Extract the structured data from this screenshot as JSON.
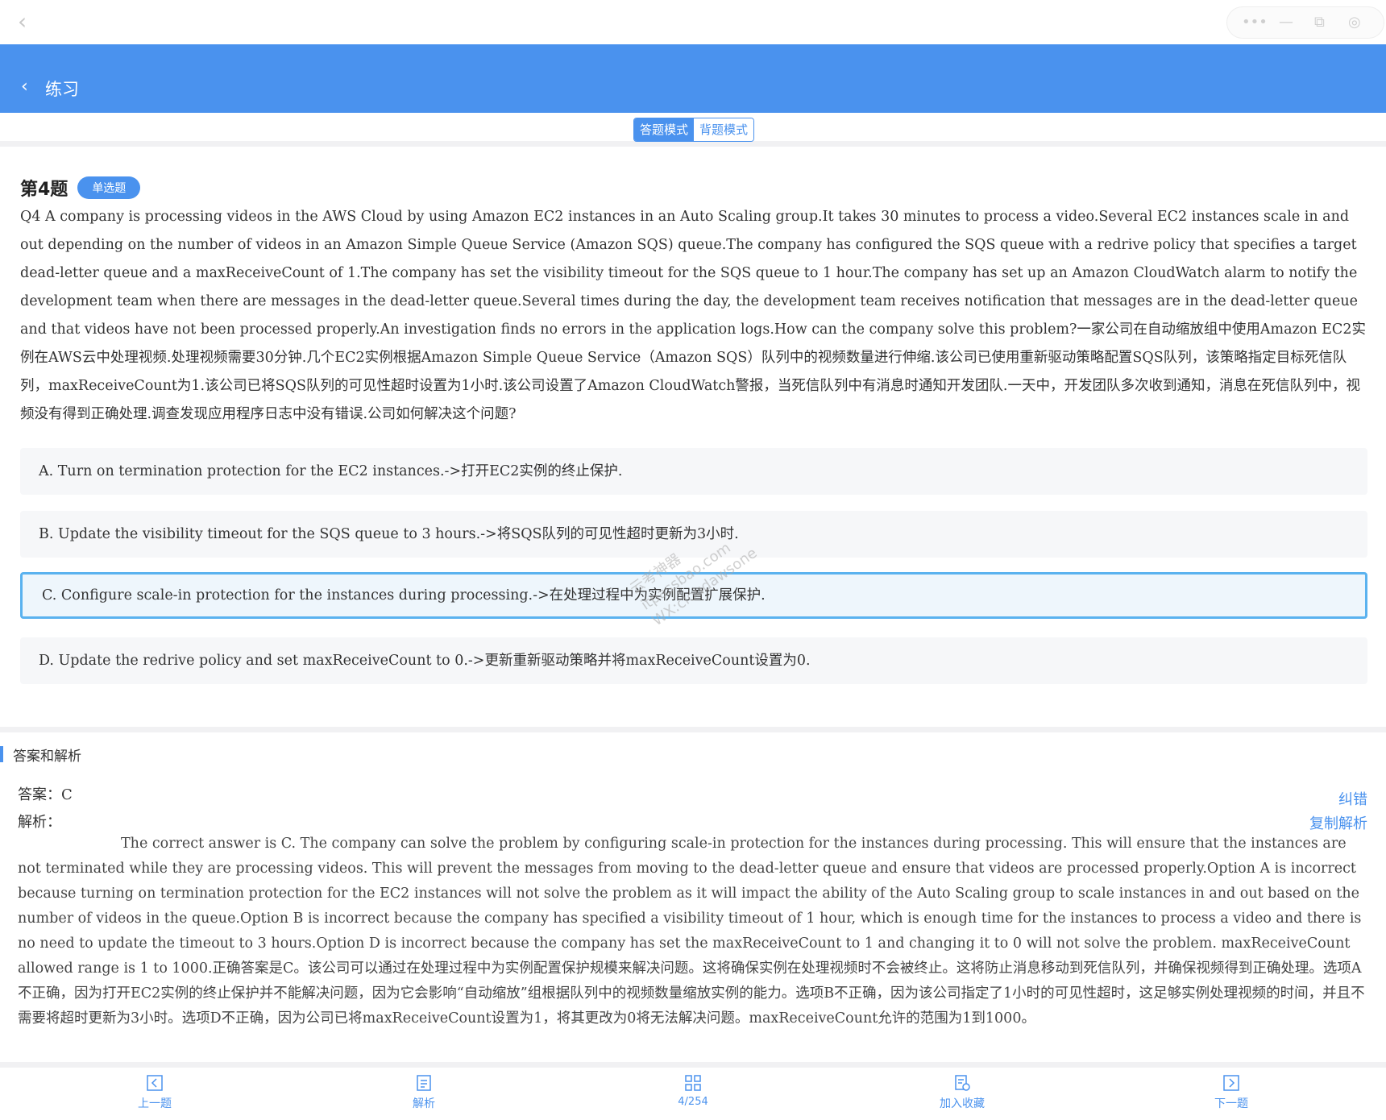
{
  "topbar": {
    "back_icon": "chevron-left-icon",
    "capsule_icons": [
      "more-dots-icon",
      "minimize-icon",
      "restore-icon",
      "close-circle-icon"
    ]
  },
  "header": {
    "back_glyph": "‹",
    "title": "练习"
  },
  "mode": {
    "answer_mode": "答题模式",
    "recite_mode": "背题模式"
  },
  "question": {
    "number": "第4题",
    "type": "单选题",
    "text": "Q4 A company is processing videos in the AWS Cloud by using Amazon EC2 instances in an Auto Scaling group.It takes 30 minutes to process a video.Several EC2 instances scale in and out depending on the number of videos in an Amazon Simple Queue Service (Amazon SQS) queue.The company has configured the SQS queue with a redrive policy that specifies a target dead-letter queue and a maxReceiveCount of 1.The company has set the visibility timeout for the SQS queue to 1 hour.The company has set up an Amazon CloudWatch alarm to notify the development team when there are messages in the dead-letter queue.Several times during the day, the development team receives notification that messages are in the dead-letter queue and that videos have not been processed properly.An investigation finds no errors in the application logs.How can the company solve this problem?一家公司在自动缩放组中使用Amazon EC2实例在AWS云中处理视频.处理视频需要30分钟.几个EC2实例根据Amazon Simple Queue Service（Amazon SQS）队列中的视频数量进行伸缩.该公司已使用重新驱动策略配置SQS队列，该策略指定目标死信队列，maxReceiveCount为1.该公司已将SQS队列的可见性超时设置为1小时.该公司设置了Amazon CloudWatch警报，当死信队列中有消息时通知开发团队.一天中，开发团队多次收到通知，消息在死信队列中，视频没有得到正确处理.调查发现应用程序日志中没有错误.公司如何解决这个问题?",
    "options": [
      {
        "text": "A. Turn on termination protection for the EC2 instances.->打开EC2实例的终止保护."
      },
      {
        "text": "B. Update the visibility timeout for the SQS queue to 3 hours.->将SQS队列的可见性超时更新为3小时."
      },
      {
        "text": "C. Configure scale-in protection for the instances during processing.->在处理过程中为实例配置扩展保护."
      },
      {
        "text": "D. Update the redrive policy and set maxReceiveCount to 0.->更新重新驱动策略并将maxReceiveCount设置为0."
      }
    ],
    "selected": "C"
  },
  "watermark": {
    "lines": [
      "云考神器",
      "itpassbao.com",
      "WX:cloudawsone"
    ]
  },
  "answer": {
    "section_title": "答案和解析",
    "answer_label": "答案：",
    "answer_value": "C",
    "analysis_label": "解析：",
    "report_error": "纠错",
    "copy_analysis": "复制解析",
    "analysis_text": "The correct answer is C. The company can solve the problem by configuring scale-in protection for the instances during processing. This will ensure that the instances are not terminated while they are processing videos. This will prevent the messages from moving to the dead-letter queue and ensure that videos are processed properly.Option A is incorrect because turning on termination protection for the EC2 instances will not solve the problem as it will impact the ability of the Auto Scaling group to scale instances in and out based on the number of videos in the queue.Option B is incorrect because the company has specified a visibility timeout of 1 hour, which is enough time for the instances to process a video and there is no need to update the timeout to 3 hours.Option D is incorrect because the company has set the maxReceiveCount to 1 and changing it to 0 will not solve the problem. maxReceiveCount allowed range is 1 to 1000.正确答案是C。该公司可以通过在处理过程中为实例配置保护规模来解决问题。这将确保实例在处理视频时不会被终止。这将防止消息移动到死信队列，并确保视频得到正确处理。选项A不正确，因为打开EC2实例的终止保护并不能解决问题，因为它会影响“自动缩放”组根据队列中的视频数量缩放实例的能力。选项B不正确，因为该公司指定了1小时的可见性超时，这足够实例处理视频的时间，并且不需要将超时更新为3小时。选项D不正确，因为公司已将maxReceiveCount设置为1，将其更改为0将无法解决问题。maxReceiveCount允许的范围为1到1000。"
  },
  "bottom_nav": {
    "prev": "上一题",
    "analysis": "解析",
    "progress": "4/254",
    "favorite": "加入收藏",
    "next": "下一题"
  },
  "colors": {
    "accent": "#4a92ee",
    "selected_border": "#5ab2ef",
    "option_bg": "#f6f7f9"
  }
}
